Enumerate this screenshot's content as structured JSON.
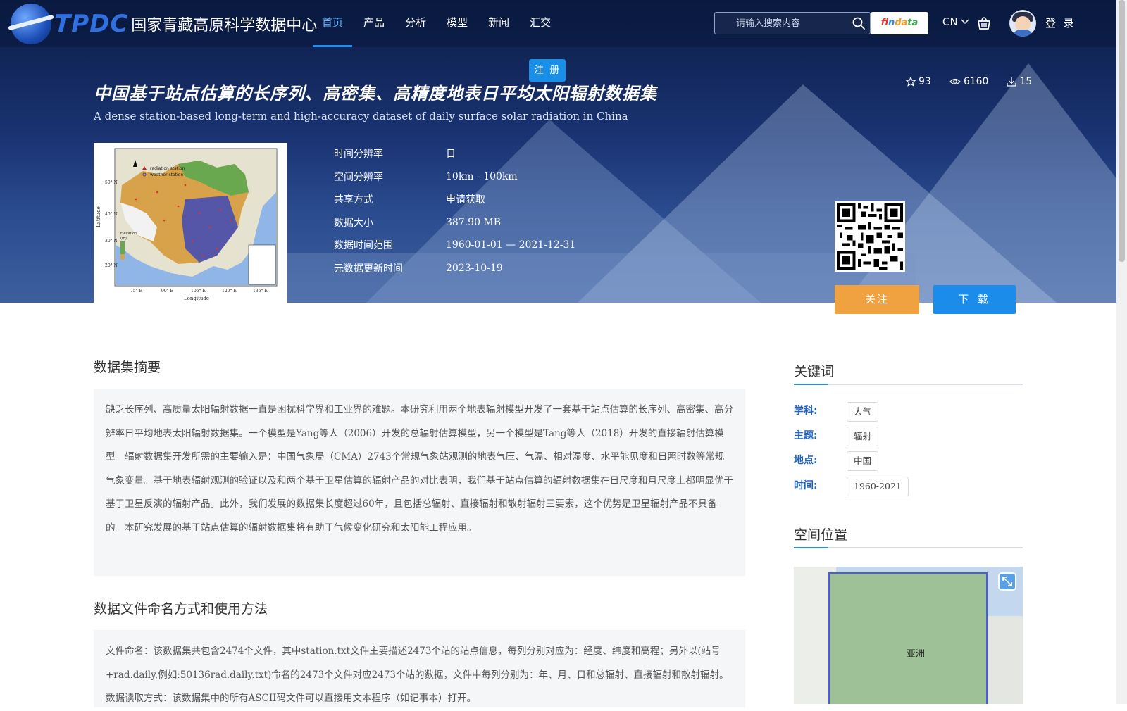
{
  "header": {
    "logo_abbr": "TPDC",
    "logo_name": "国家青藏高原科学数据中心",
    "menu": [
      {
        "label": "首页",
        "active": true
      },
      {
        "label": "产品"
      },
      {
        "label": "分析"
      },
      {
        "label": "模型"
      },
      {
        "label": "新闻"
      },
      {
        "label": "汇交"
      }
    ],
    "search_placeholder": "请输入搜索内容",
    "findata_label": "findata",
    "lang": "CN",
    "login": "登 录",
    "register": "注 册"
  },
  "dataset": {
    "title_cn": "中国基于站点估算的长序列、高密集、高精度地表日平均太阳辐射数据集",
    "title_en": "A dense station-based long-term and high-accuracy dataset of daily surface solar radiation in China",
    "stats": {
      "stars": "93",
      "views": "6160",
      "downloads": "15"
    },
    "meta": [
      {
        "key": "时间分辨率",
        "value": "日"
      },
      {
        "key": "空间分辨率",
        "value": "10km - 100km"
      },
      {
        "key": "共享方式",
        "value": "申请获取"
      },
      {
        "key": "数据大小",
        "value": "387.90 MB"
      },
      {
        "key": "数据时间范围",
        "value": "1960-01-01 — 2021-12-31"
      },
      {
        "key": "元数据更新时间",
        "value": "2023-10-19"
      }
    ],
    "follow_label": "关注",
    "download_label": "下 载",
    "thumbnail": {
      "legend_1": "radiation station",
      "legend_2": "weather station",
      "xlabel": "Longitude",
      "ylabel": "Latitude",
      "x_ticks": [
        "75° E",
        "90° E",
        "105° E",
        "120° E",
        "135° E"
      ],
      "y_ticks": [
        "50° N",
        "40° N",
        "30° N",
        "20° N"
      ],
      "elevation_label": "Elevation",
      "elevation_unit": "(m)"
    }
  },
  "abstract": {
    "title": "数据集摘要",
    "text": "缺乏长序列、高质量太阳辐射数据一直是困扰科学界和工业界的难题。本研究利用两个地表辐射模型开发了一套基于站点估算的长序列、高密集、高分辨率日平均地表太阳辐射数据集。一个模型是Yang等人（2006）开发的总辐射估算模型，另一个模型是Tang等人（2018）开发的直接辐射估算模型。辐射数据集开发所需的主要输入是：中国气象局（CMA）2743个常规气象站观测的地表气压、气温、相对湿度、水平能见度和日照时数等常规气象变量。基于地表辐射观测的验证以及和两个基于卫星估算的辐射产品的对比表明，我们基于站点估算的辐射数据集在日尺度和月尺度上都明显优于基于卫星反演的辐射产品。此外，我们发展的数据集长度超过60年，且包括总辐射、直接辐射和散射辐射三要素，这个优势是卫星辐射产品不具备的。本研究发展的基于站点估算的辐射数据集将有助于气候变化研究和太阳能工程应用。"
  },
  "usage": {
    "title": "数据文件命名方式和使用方法",
    "text": "文件命名：该数据集共包含2474个文件，其中station.txt文件主要描述2473个站的站点信息，每列分别对应为：经度、纬度和高程；另外以(站号+rad.daily,例如:50136rad.daily.txt)命名的2473个文件对应2473个站的数据，文件中每列分别为：年、月、日和总辐射、直接辐射和散射辐射。 数据读取方式：该数据集中的所有ASCII码文件可以直接用文本程序（如记事本）打开。"
  },
  "keywords": {
    "title": "关键词",
    "items": [
      {
        "label": "学科:",
        "tag": "大气"
      },
      {
        "label": "主题:",
        "tag": "辐射"
      },
      {
        "label": "地点:",
        "tag": "中国"
      },
      {
        "label": "时间:",
        "tag": "1960-2021"
      }
    ]
  },
  "spatial": {
    "title": "空间位置",
    "region_label": "亚洲"
  }
}
